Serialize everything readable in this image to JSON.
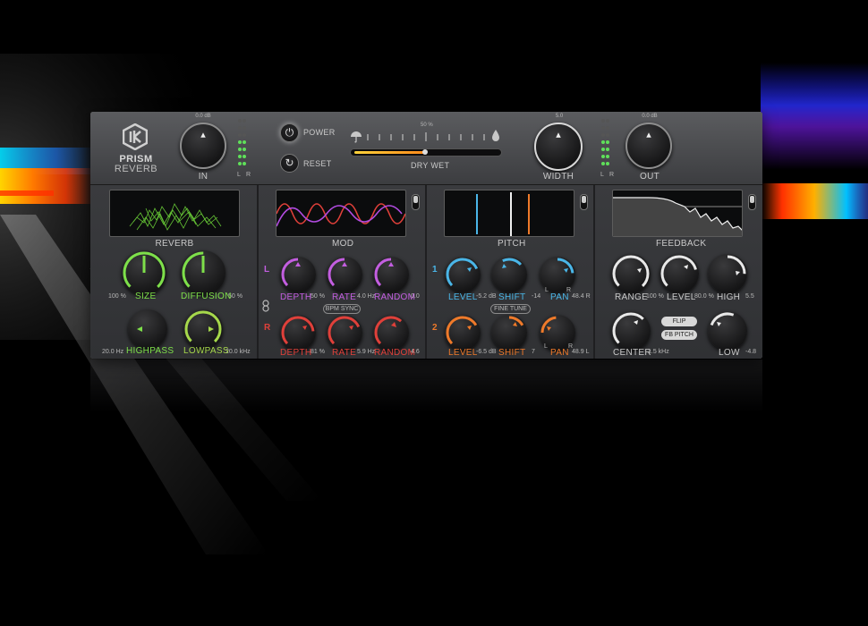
{
  "brand": {
    "name_line1": "PRISM",
    "name_line2": "REVERB"
  },
  "io": {
    "in_label": "IN",
    "in_value": "0.0 dB",
    "out_label": "OUT",
    "out_value": "0.0 dB",
    "width_label": "WIDTH",
    "width_value": "5.0",
    "meter_l": "L",
    "meter_r": "R"
  },
  "controls": {
    "power_label": "POWER",
    "reset_label": "RESET"
  },
  "drywet": {
    "label": "DRY WET",
    "value": "50 %",
    "level": 0.5
  },
  "sections": {
    "reverb": {
      "title": "REVERB",
      "size_label": "SIZE",
      "size_value": "100 %",
      "diffusion_label": "DIFFUSION",
      "diffusion_value": "50 %",
      "highpass_label": "HIGHPASS",
      "highpass_value": "20.0 Hz",
      "lowpass_label": "LOWPASS",
      "lowpass_value": "20.0 kHz"
    },
    "mod": {
      "title": "MOD",
      "row_l": "L",
      "row_r": "R",
      "depth_label": "DEPTH",
      "rate_label": "RATE",
      "random_label": "RANDOM",
      "l_depth_value": "50 %",
      "l_rate_value": "4.0 Hz",
      "l_random_value": "0.0",
      "r_depth_value": "81 %",
      "r_rate_value": "5.9 Hz",
      "r_random_value": "4.6",
      "bpm_sync_label": "BPM SYNC"
    },
    "pitch": {
      "title": "PITCH",
      "row_1": "1",
      "row_2": "2",
      "level_label": "LEVEL",
      "shift_label": "SHIFT",
      "pan_label": "PAN",
      "v1_level_value": "-5.2 dB",
      "v1_shift_value": "-14",
      "v1_pan_value": "48.4 R",
      "v2_level_value": "-6.5 dB",
      "v2_shift_value": "7",
      "v2_pan_value": "48.9 L",
      "fine_tune_label": "FINE TUNE",
      "pan_l": "L",
      "pan_r": "R"
    },
    "feedback": {
      "title": "FEEDBACK",
      "range_label": "RANGE",
      "range_value": "100 %",
      "level_label": "LEVEL",
      "level_value": "80.0 %",
      "high_label": "HIGH",
      "high_value": "5.5",
      "center_label": "CENTER",
      "center_value": "1.5 kHz",
      "low_label": "LOW",
      "low_value": "-4.8",
      "flip_label": "FLIP",
      "fb_pitch_label": "FB PITCH"
    }
  },
  "colors": {
    "reverb_green": "#7ee04a",
    "lowpass_green": "#a6d84b",
    "mod_purple": "#c35ee0",
    "mod_red": "#e0403a",
    "pitch_blue": "#4ab6e8",
    "pitch_orange": "#ef7a2a",
    "feedback_white": "#e8e8e8",
    "meter_green": "#5fe05a"
  },
  "icons": {
    "logo": "prism-logo-icon",
    "power": "power-icon",
    "reset": "reset-icon",
    "dry": "umbrella-icon",
    "wet": "droplet-icon",
    "link": "link-icon"
  }
}
